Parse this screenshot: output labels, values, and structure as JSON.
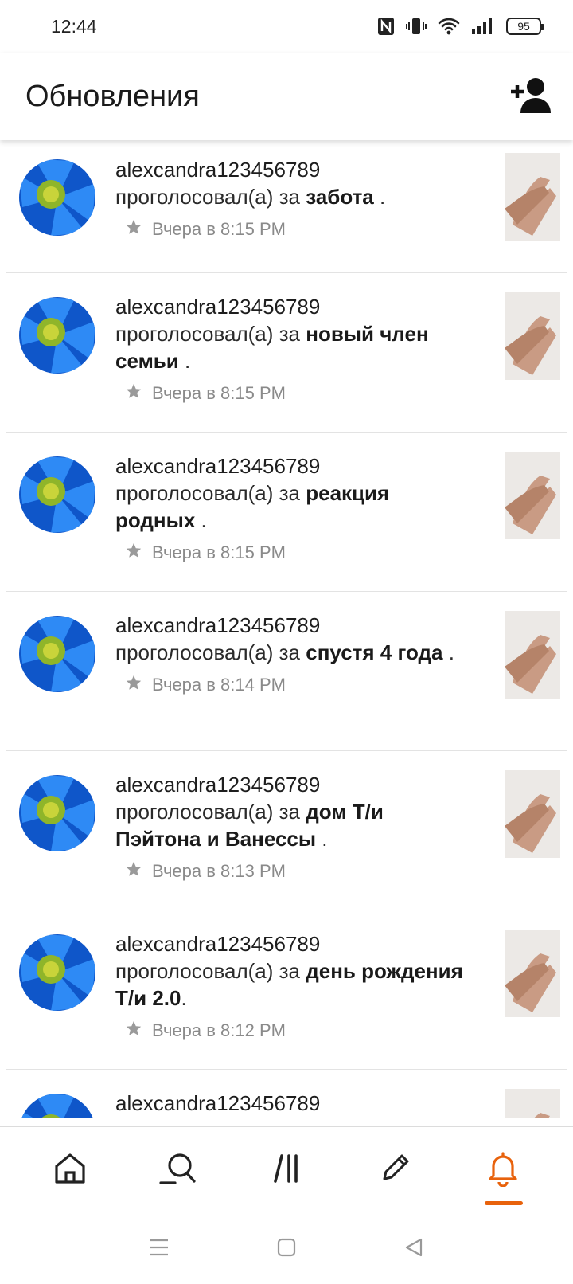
{
  "status_bar": {
    "time": "12:44",
    "battery": "95",
    "icons": [
      "nfc-icon",
      "vibrate-icon",
      "wifi-icon",
      "signal-icon",
      "battery-icon"
    ]
  },
  "header": {
    "title": "Обновления",
    "add_user_icon": "add-person-icon"
  },
  "colors": {
    "accent": "#e8620c",
    "meta_text": "#8a8a8a",
    "avatar_blue": "#1f74e6",
    "avatar_center": "#8fb52a"
  },
  "feed": {
    "items": [
      {
        "username": "alexcandra123456789",
        "action_prefix": "проголосовал(а) за ",
        "target": "забота",
        "suffix": " .",
        "time": "Вчера в 8:15 PM"
      },
      {
        "username": "alexcandra123456789",
        "action_prefix": "проголосовал(а) за ",
        "target": "новый член семьи",
        "suffix": " .",
        "time": "Вчера в 8:15 PM"
      },
      {
        "username": "alexcandra123456789",
        "action_prefix": "проголосовал(а) за ",
        "target": "реакция родных",
        "suffix": " .",
        "time": "Вчера в 8:15 PM"
      },
      {
        "username": "alexcandra123456789",
        "action_prefix": "проголосовал(а) за ",
        "target": "спустя 4 года",
        "suffix": " .",
        "time": "Вчера в 8:14 PM"
      },
      {
        "username": "alexcandra123456789",
        "action_prefix": "проголосовал(а) за ",
        "target": "дом Т/и Пэйтона и Ванессы",
        "suffix": " .",
        "time": "Вчера в 8:13 PM"
      },
      {
        "username": "alexcandra123456789",
        "action_prefix": "проголосовал(а) за ",
        "target": "день рождения Т/и 2.0",
        "suffix": ".",
        "time": "Вчера в 8:12 PM"
      },
      {
        "username": "alexcandra123456789"
      }
    ]
  },
  "bottom_nav": {
    "items": [
      "home-icon",
      "search-icon",
      "library-icon",
      "write-icon",
      "notifications-bell-icon"
    ],
    "active": "notifications-bell-icon"
  },
  "system_nav": [
    "menu-icon",
    "home-square-icon",
    "back-triangle-icon"
  ]
}
